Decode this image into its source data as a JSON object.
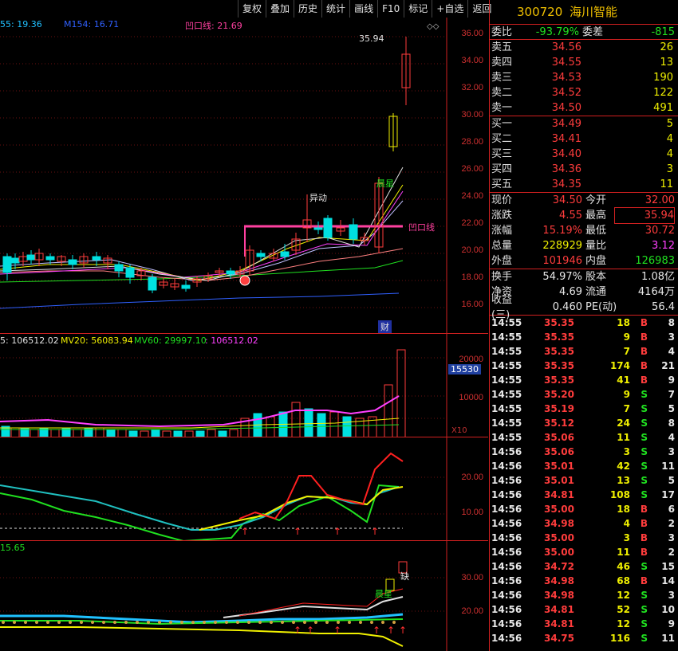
{
  "toolbar": [
    "复权",
    "叠加",
    "历史",
    "统计",
    "画线",
    "F10",
    "标记",
    "+自选",
    "返回"
  ],
  "main_chart": {
    "ma_labels": [
      {
        "text": "55: 19.36",
        "color": "#20c0ff"
      },
      {
        "text": "M154: 16.71",
        "color": "#3060ff"
      },
      {
        "text": "凹口线: 21.69",
        "color": "#ff40a0"
      }
    ],
    "high_label": "35.94",
    "annotations": {
      "yidong": "异动",
      "chenxing": "晨星",
      "aokou": "凹口线",
      "cai": "财"
    },
    "y_ticks": [
      "36.00",
      "34.00",
      "32.00",
      "30.00",
      "28.00",
      "26.00",
      "24.00",
      "22.00",
      "20.00",
      "18.00",
      "16.00"
    ]
  },
  "volume_chart": {
    "labels": [
      {
        "text": "5: 106512.02",
        "color": "#e0e0e0"
      },
      {
        "text": "MV20: 56083.94",
        "color": "#f0f000"
      },
      {
        "text": "MV60: 29997.10",
        "color": "#20e020"
      },
      {
        "text": ": 106512.02",
        "color": "#ff40ff"
      }
    ],
    "y_ticks": [
      "20000",
      "10000"
    ],
    "current_box": "15530",
    "multiplier": "X10"
  },
  "indicator_chart": {
    "y_ticks": [
      "20.00",
      "10.00"
    ]
  },
  "bottom_chart": {
    "label": "15.65",
    "y_ticks": [
      "30.00",
      "20.00"
    ],
    "annotations": {
      "que": "缺",
      "chenxing": "晨星"
    }
  },
  "quote": {
    "code": "300720",
    "name": "海川智能",
    "weibi_label": "委比",
    "weibi_value": "-93.79%",
    "weicha_label": "委差",
    "weicha_value": "-815",
    "asks": [
      {
        "label": "卖五",
        "price": "34.56",
        "vol": "26"
      },
      {
        "label": "卖四",
        "price": "34.55",
        "vol": "13"
      },
      {
        "label": "卖三",
        "price": "34.53",
        "vol": "190"
      },
      {
        "label": "卖二",
        "price": "34.52",
        "vol": "122"
      },
      {
        "label": "卖一",
        "price": "34.50",
        "vol": "491"
      }
    ],
    "bids": [
      {
        "label": "买一",
        "price": "34.49",
        "vol": "5"
      },
      {
        "label": "买二",
        "price": "34.41",
        "vol": "4"
      },
      {
        "label": "买三",
        "price": "34.40",
        "vol": "4"
      },
      {
        "label": "买四",
        "price": "34.36",
        "vol": "3"
      },
      {
        "label": "买五",
        "price": "34.35",
        "vol": "11"
      }
    ],
    "stats": [
      {
        "l1": "现价",
        "v1": "34.50",
        "c1": "red",
        "l2": "今开",
        "v2": "32.00",
        "c2": "red"
      },
      {
        "l1": "涨跌",
        "v1": "4.55",
        "c1": "red",
        "l2": "最高",
        "v2": "35.94",
        "c2": "red"
      },
      {
        "l1": "涨幅",
        "v1": "15.19%",
        "c1": "red",
        "l2": "最低",
        "v2": "30.72",
        "c2": "red"
      },
      {
        "l1": "总量",
        "v1": "228929",
        "c1": "yellow",
        "l2": "量比",
        "v2": "3.12",
        "c2": "magenta"
      },
      {
        "l1": "外盘",
        "v1": "101946",
        "c1": "red",
        "l2": "内盘",
        "v2": "126983",
        "c2": "green"
      }
    ],
    "stats2": [
      {
        "l1": "换手",
        "v1": "54.97%",
        "l2": "股本",
        "v2": "1.08亿"
      },
      {
        "l1": "净资",
        "v1": "4.69",
        "l2": "流通",
        "v2": "4164万"
      },
      {
        "l1": "收益(三)",
        "v1": "0.460",
        "l2": "PE(动)",
        "v2": "56.4"
      }
    ],
    "ticks": [
      {
        "t": "14:55",
        "p": "35.35",
        "pc": "red",
        "v": "18",
        "d": "B",
        "n": "8"
      },
      {
        "t": "14:55",
        "p": "35.35",
        "pc": "red",
        "v": "9",
        "d": "B",
        "n": "3"
      },
      {
        "t": "14:55",
        "p": "35.35",
        "pc": "red",
        "v": "7",
        "d": "B",
        "n": "4"
      },
      {
        "t": "14:55",
        "p": "35.35",
        "pc": "red",
        "v": "174",
        "d": "B",
        "n": "21"
      },
      {
        "t": "14:55",
        "p": "35.35",
        "pc": "red",
        "v": "41",
        "d": "B",
        "n": "9"
      },
      {
        "t": "14:55",
        "p": "35.20",
        "pc": "red",
        "v": "9",
        "d": "S",
        "n": "7"
      },
      {
        "t": "14:55",
        "p": "35.19",
        "pc": "red",
        "v": "7",
        "d": "S",
        "n": "5"
      },
      {
        "t": "14:55",
        "p": "35.12",
        "pc": "red",
        "v": "24",
        "d": "S",
        "n": "8"
      },
      {
        "t": "14:55",
        "p": "35.06",
        "pc": "red",
        "v": "11",
        "d": "S",
        "n": "4"
      },
      {
        "t": "14:56",
        "p": "35.06",
        "pc": "red",
        "v": "3",
        "d": "S",
        "n": "3"
      },
      {
        "t": "14:56",
        "p": "35.01",
        "pc": "red",
        "v": "42",
        "d": "S",
        "n": "11"
      },
      {
        "t": "14:56",
        "p": "35.01",
        "pc": "red",
        "v": "13",
        "d": "S",
        "n": "5"
      },
      {
        "t": "14:56",
        "p": "34.81",
        "pc": "red",
        "v": "108",
        "d": "S",
        "n": "17"
      },
      {
        "t": "14:56",
        "p": "35.00",
        "pc": "red",
        "v": "18",
        "d": "B",
        "n": "6"
      },
      {
        "t": "14:56",
        "p": "34.98",
        "pc": "red",
        "v": "4",
        "d": "B",
        "n": "2"
      },
      {
        "t": "14:56",
        "p": "35.00",
        "pc": "red",
        "v": "3",
        "d": "B",
        "n": "3"
      },
      {
        "t": "14:56",
        "p": "35.00",
        "pc": "red",
        "v": "11",
        "d": "B",
        "n": "2"
      },
      {
        "t": "14:56",
        "p": "34.72",
        "pc": "red",
        "v": "46",
        "d": "S",
        "n": "15"
      },
      {
        "t": "14:56",
        "p": "34.98",
        "pc": "red",
        "v": "68",
        "d": "B",
        "n": "14"
      },
      {
        "t": "14:56",
        "p": "34.98",
        "pc": "red",
        "v": "12",
        "d": "S",
        "n": "3"
      },
      {
        "t": "14:56",
        "p": "34.81",
        "pc": "red",
        "v": "52",
        "d": "S",
        "n": "10"
      },
      {
        "t": "14:56",
        "p": "34.81",
        "pc": "red",
        "v": "12",
        "d": "S",
        "n": "9"
      },
      {
        "t": "14:56",
        "p": "34.75",
        "pc": "red",
        "v": "116",
        "d": "S",
        "n": "11"
      }
    ]
  }
}
